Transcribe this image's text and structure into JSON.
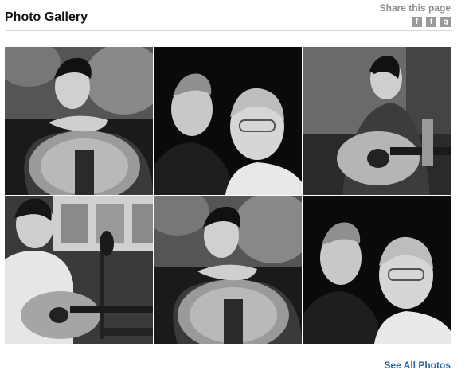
{
  "header": {
    "title": "Photo Gallery",
    "share_label": "Share this page",
    "share_icons": [
      "facebook-icon",
      "twitter-icon",
      "google-plus-icon"
    ]
  },
  "gallery": {
    "photos": [
      {
        "subject": "man-leaning-on-guitar"
      },
      {
        "subject": "two-men-portrait"
      },
      {
        "subject": "man-playing-guitar"
      },
      {
        "subject": "guitarist-in-studio"
      },
      {
        "subject": "man-leaning-on-guitar"
      },
      {
        "subject": "two-men-portrait"
      }
    ]
  },
  "footer": {
    "see_all": "See All Photos"
  },
  "colors": {
    "link": "#2a66a8",
    "muted": "#8e8e8e",
    "divider": "#d8d8d8"
  }
}
